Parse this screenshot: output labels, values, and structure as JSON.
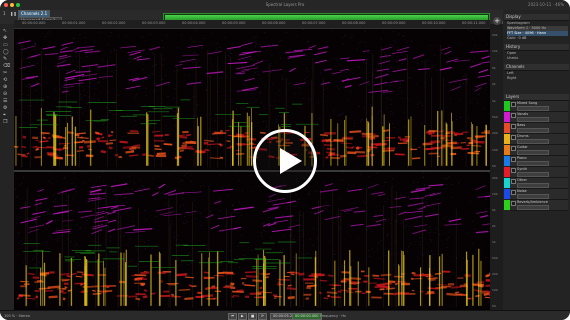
{
  "window": {
    "title": "Spectral Layers Pro",
    "right_text": "2023-10-11 · 46%"
  },
  "toolbar": {
    "items": [
      "1",
      "Channels 2.1",
      "Untitled Project"
    ],
    "active_layer": "Unnamed Song 1 ▾"
  },
  "ruler": {
    "ticks": [
      "00:00:00.000",
      "00:00:01.000",
      "00:00:02.000",
      "00:00:03.000",
      "00:00:04.000",
      "00:00:05.000",
      "00:00:06.000",
      "00:00:07.000",
      "00:00:08.000",
      "00:00:09.000",
      "00:00:10.000",
      "00:00:11.000",
      "00:00:12.000"
    ]
  },
  "freq_labels_top": [
    "20k",
    "10k",
    "5k",
    "2k",
    "1k",
    "500",
    "200",
    "100",
    "50"
  ],
  "freq_labels_bottom": [
    "20k",
    "10k",
    "5k",
    "2k",
    "1k",
    "500",
    "200",
    "100",
    "50"
  ],
  "left_tools": [
    "↖",
    "✥",
    "▭",
    "◯",
    "✎",
    "⌫",
    "✂",
    "⟲",
    "⊕",
    "⊖",
    "☰",
    "⚙",
    "⌖",
    "❐"
  ],
  "panels": {
    "display": {
      "title": "Display",
      "rows": [
        "Spectrogram",
        "Waveform 1 · 5000 Hz",
        "FFT Size · 4096 · Hann",
        "Gain: ·0 dB"
      ]
    },
    "history": {
      "title": "History",
      "rows": [
        "Open",
        "Unmix"
      ]
    },
    "channels": {
      "title": "Channels",
      "rows": [
        "Left",
        "Right"
      ]
    },
    "layers": {
      "title": "Layers"
    }
  },
  "tracks": [
    {
      "name": "Mixed Song",
      "color": "#1fc61f"
    },
    {
      "name": "Vocals",
      "color": "#d21ad2"
    },
    {
      "name": "Bass",
      "color": "#e84b2a"
    },
    {
      "name": "Drums",
      "color": "#e8b01a"
    },
    {
      "name": "Guitar",
      "color": "#e87a1a"
    },
    {
      "name": "Piano",
      "color": "#1a7ae8"
    },
    {
      "name": "Synth",
      "color": "#e81a2a"
    },
    {
      "name": "Other",
      "color": "#1ad2d2"
    },
    {
      "name": "Noise",
      "color": "#1a4ae8"
    },
    {
      "name": "Reverb/Ambience",
      "color": "#2ad21a"
    }
  ],
  "status": {
    "left": "100 % · Stereo",
    "time": "00:00:05.212",
    "sel": "00:00:00.000",
    "right": "Frequency · Hz"
  },
  "overlay": {
    "play_label": "play"
  }
}
